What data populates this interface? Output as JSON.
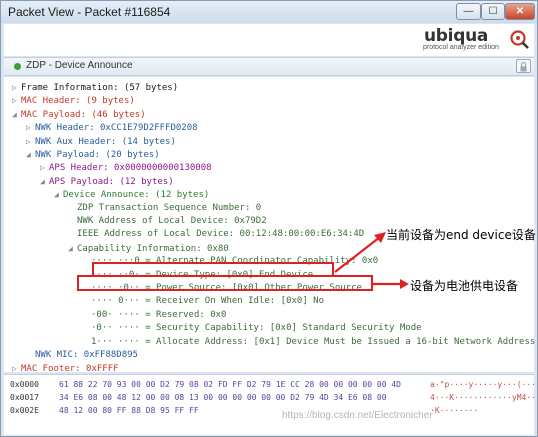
{
  "window": {
    "title": "Packet View - Packet #116854",
    "minimize_glyph": "—",
    "maximize_glyph": "☐",
    "close_glyph": "✕"
  },
  "header": {
    "logo_text": "ubiqua",
    "logo_subtitle": "protocol analyzer edition",
    "logo_icon": "magnifier-radar-icon"
  },
  "breadcrumb": {
    "text": "ZDP - Device Announce",
    "status_color": "#3a9e3a",
    "lock_icon": "lock-icon"
  },
  "tree": {
    "rows": [
      {
        "text": "Frame Information: (57 bytes)",
        "color": "black",
        "expander": "▷"
      },
      {
        "text": "MAC Header: (9 bytes)",
        "color": "red",
        "expander": "▷"
      },
      {
        "text": "MAC Payload: (46 bytes)",
        "color": "red",
        "expander": "◢"
      },
      {
        "text": "NWK Header: 0xCC1E79D2FFFD0208",
        "color": "blue",
        "expander": "▷"
      },
      {
        "text": "NWK Aux Header: (14 bytes)",
        "color": "blue",
        "expander": "▷"
      },
      {
        "text": "NWK Payload: (20 bytes)",
        "color": "blue",
        "expander": "◢"
      },
      {
        "text": "APS Header: 0x0000000000130008",
        "color": "purple",
        "expander": "▷"
      },
      {
        "text": "APS Payload: (12 bytes)",
        "color": "purple",
        "expander": "◢"
      },
      {
        "text": "Device Announce: (12 bytes)",
        "color": "green",
        "expander": "◢"
      },
      {
        "text": "ZDP Transaction Sequence Number: 0",
        "color": "darkgreen",
        "expander": ""
      },
      {
        "text": "NWK Address of Local Device: 0x79D2",
        "color": "darkgreen",
        "expander": ""
      },
      {
        "text": "IEEE Address of Local Device: 00:12:48:00:00:E6:34:4D",
        "color": "darkgreen",
        "expander": ""
      },
      {
        "text": "Capability Information: 0x80",
        "color": "darkgreen",
        "expander": "◢"
      },
      {
        "text": "···· ···0 = Alternate PAN Coordinator Capability: 0x0",
        "color": "darkgreen",
        "expander": ""
      },
      {
        "text": "···· ··0· = Device Type: [0x0] End Device",
        "color": "darkgreen",
        "expander": ""
      },
      {
        "text": "···· ·0·· = Power Source: [0x0] Other Power Source",
        "color": "darkgreen",
        "expander": ""
      },
      {
        "text": "···· 0··· = Receiver On When Idle: [0x0] No",
        "color": "darkgreen",
        "expander": ""
      },
      {
        "text": "·00· ···· = Reserved: 0x0",
        "color": "darkgreen",
        "expander": ""
      },
      {
        "text": "·0·· ···· = Security Capability: [0x0] Standard Security Mode",
        "color": "darkgreen",
        "expander": ""
      },
      {
        "text": "1··· ···· = Allocate Address: [0x1] Device Must be Issued a 16-bit Network Address",
        "color": "darkgreen",
        "expander": ""
      },
      {
        "text": "NWK MIC: 0xFF88D895",
        "color": "blue",
        "expander": ""
      },
      {
        "text": "MAC Footer: 0xFFFF",
        "color": "red",
        "expander": "▷"
      }
    ]
  },
  "annotations": {
    "device_type": "当前设备为end device设备",
    "power_source": "设备为电池供电设备"
  },
  "hex": {
    "rows": [
      {
        "offset": "0x0000",
        "bytes": "61 88 22 70 93 00 00 D2 79 08 02 FD FF D2 79 1E CC 28 00 00 00 00 00 4D",
        "ascii": "a·\"p····y·····y···(····M"
      },
      {
        "offset": "0x0017",
        "bytes": "34 E6 08 00 48 12 00 00 08 13 00 00 00 00 00 00 D2 79 4D 34 E6 08 00",
        "ascii": "4···K············yM4···"
      },
      {
        "offset": "0x002E",
        "bytes": "48 12 00 80 FF 88 D8 95 FF FF",
        "ascii": "·K········"
      }
    ]
  },
  "watermark": "https://blog.csdn.net/Electronicher"
}
